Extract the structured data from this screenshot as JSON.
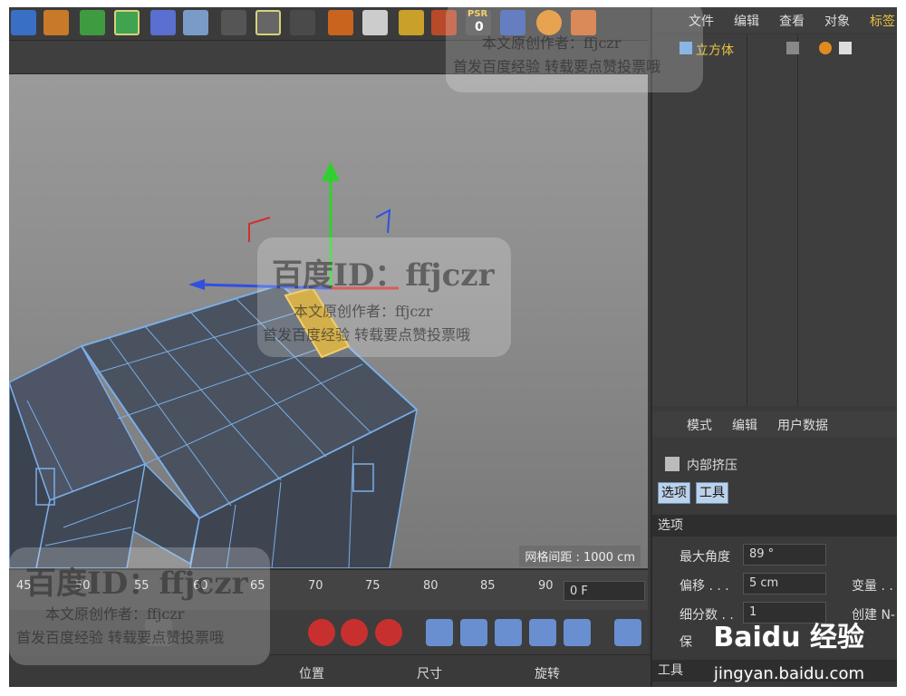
{
  "menu": {
    "file": "文件",
    "edit": "编辑",
    "view": "查看",
    "object": "对象",
    "tags": "标签"
  },
  "object_manager": {
    "object_name": "立方体"
  },
  "viewport": {
    "grid_spacing": "网格间距 : 1000 cm"
  },
  "timeline": {
    "ticks": [
      "45",
      "50",
      "55",
      "60",
      "65",
      "70",
      "75",
      "80",
      "85",
      "90"
    ],
    "current_frame": "0 F"
  },
  "coordinates": {
    "position": "位置",
    "size": "尺寸",
    "rotation": "旋转"
  },
  "attributes": {
    "menu_mode": "模式",
    "menu_edit": "编辑",
    "menu_userdata": "用户数据",
    "tool_name": "内部挤压",
    "tab_options": "选项",
    "tab_tool": "工具",
    "section_options": "选项",
    "max_angle_label": "最大角度",
    "max_angle_value": "89 °",
    "offset_label": "偏移 . . .",
    "offset_value": "5 cm",
    "subdiv_label": "细分数 . .",
    "subdiv_value": "1",
    "preserve_label": "保",
    "var_label": "变量 . .",
    "create_label": "创建 N-",
    "section_tool": "工具"
  },
  "toolbar": {
    "psr_label": "PSR",
    "psr_value": "0"
  },
  "watermark": {
    "brand": "百度ID：ffjczr",
    "line1": "本文原创作者：ffjczr",
    "line2": "首发百度经验 转载要点赞投票哦",
    "baidu_logo": "Baidu 经验",
    "baidu_url": "jingyan.baidu.com"
  },
  "colors": {
    "panel": "#3a3a3a",
    "selection_yellow": "#e0b000",
    "wire_blue": "#7aaee8",
    "tab_blue": "#bcd2ea"
  }
}
